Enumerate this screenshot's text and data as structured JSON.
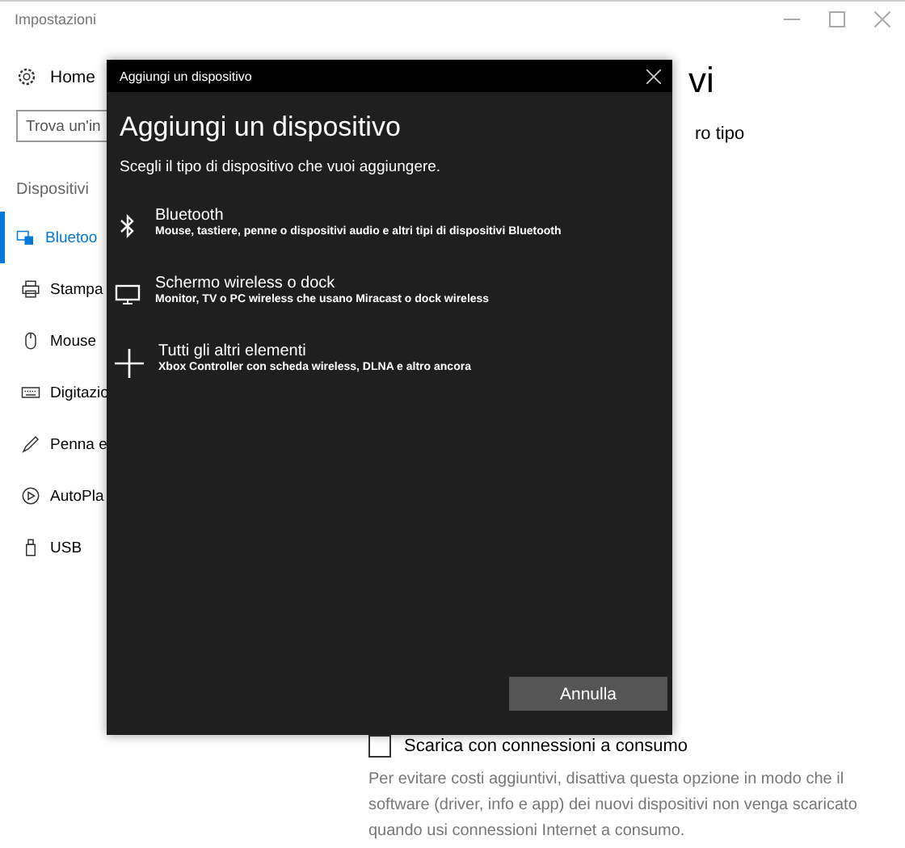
{
  "window": {
    "title": "Impostazioni"
  },
  "sidebar": {
    "home": "Home",
    "search": {
      "placeholder": "Trova un'in"
    },
    "section": "Dispositivi",
    "items": [
      {
        "label": "Bluetoo",
        "selected": true
      },
      {
        "label": "Stampa",
        "selected": false
      },
      {
        "label": "Mouse",
        "selected": false
      },
      {
        "label": "Digitazio",
        "selected": false
      },
      {
        "label": "Penna e",
        "selected": false
      },
      {
        "label": "AutoPla",
        "selected": false
      },
      {
        "label": "USB",
        "selected": false
      }
    ]
  },
  "content": {
    "heading": "vi",
    "text": "ro tipo",
    "checkbox": {
      "label": "Scarica con connessioni a consumo",
      "checked": false
    },
    "description": "Per evitare costi aggiuntivi, disattiva questa opzione in modo che il software (driver, info e app) dei nuovi dispositivi non venga scaricato quando usi connessioni Internet a consumo."
  },
  "dialog": {
    "title": "Aggiungi un dispositivo",
    "heading": "Aggiungi un dispositivo",
    "subtitle": "Scegli il tipo di dispositivo che vuoi aggiungere.",
    "options": [
      {
        "kind": "bluetooth",
        "title": "Bluetooth",
        "description": "Mouse, tastiere, penne o dispositivi audio e altri tipi di dispositivi Bluetooth"
      },
      {
        "kind": "display",
        "title": "Schermo wireless o dock",
        "description": "Monitor, TV o PC wireless che usano Miracast o dock wireless"
      },
      {
        "kind": "other",
        "title": "Tutti gli altri elementi",
        "description": "Xbox Controller con scheda wireless, DLNA e altro ancora"
      }
    ],
    "button": "Annulla"
  }
}
